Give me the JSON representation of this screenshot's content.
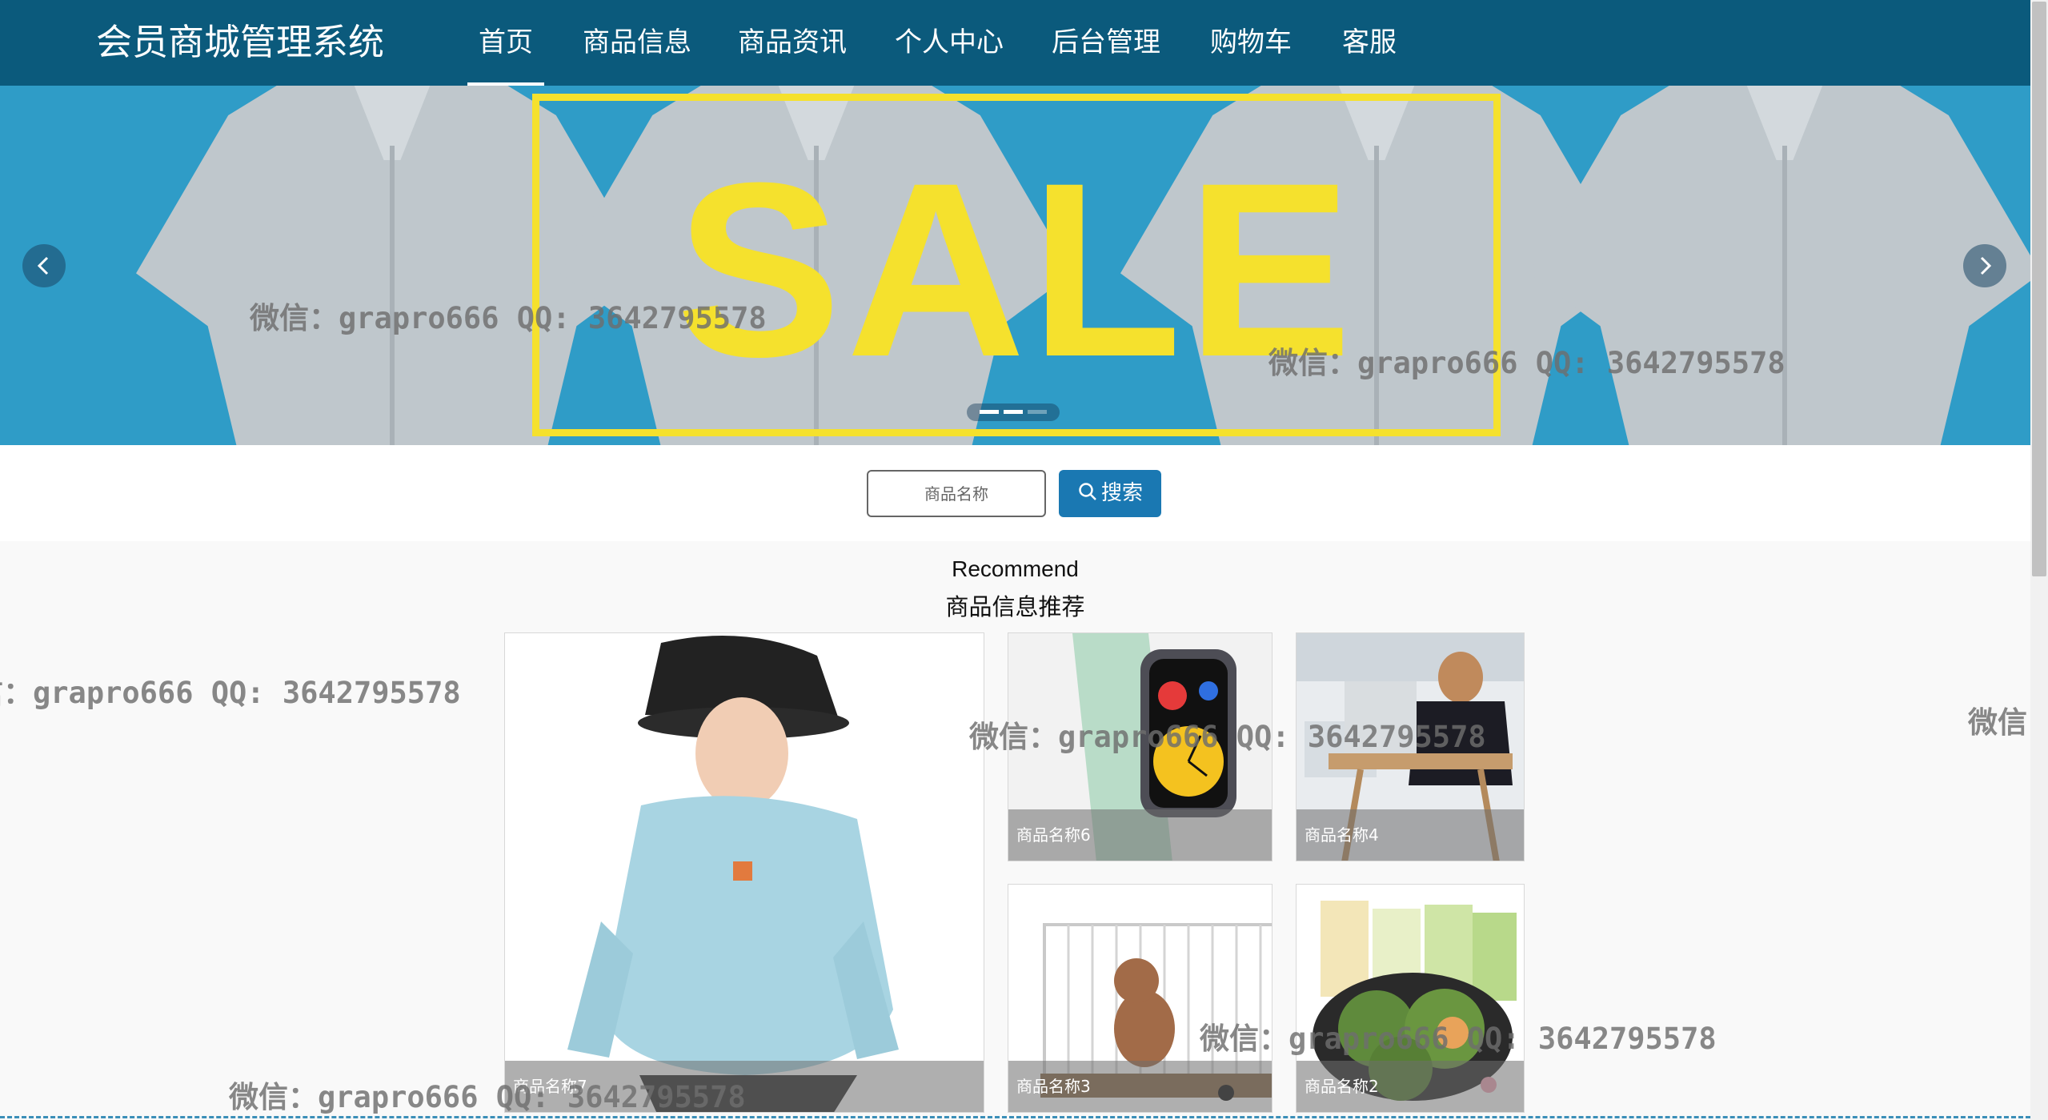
{
  "navbar": {
    "brand": "会员商城管理系统",
    "items": [
      {
        "label": "首页",
        "active": true
      },
      {
        "label": "商品信息"
      },
      {
        "label": "商品资讯"
      },
      {
        "label": "个人中心"
      },
      {
        "label": "后台管理"
      },
      {
        "label": "购物车"
      },
      {
        "label": "客服"
      }
    ],
    "color": "#0b5a7c"
  },
  "banner": {
    "sale_text": "SALE",
    "prev_icon": "chevron-left-icon",
    "next_icon": "chevron-right-icon",
    "slide_count": 3,
    "active_slide": 3,
    "colors": {
      "background": "#2f9cc7",
      "sale": "#f5e12d"
    }
  },
  "search": {
    "placeholder": "商品名称",
    "button_label": "搜索",
    "button_icon": "search-icon",
    "button_color": "#1a78b2"
  },
  "recommend": {
    "title_en": "Recommend",
    "title_cn": "商品信息推荐",
    "products": [
      {
        "name": "商品名称7",
        "image": "hoodie-photo"
      },
      {
        "name": "商品名称6",
        "image": "smartwatch-photo"
      },
      {
        "name": "商品名称4",
        "image": "laptop-desk-photo"
      },
      {
        "name": "商品名称3",
        "image": "dog-cage-photo"
      },
      {
        "name": "商品名称2",
        "image": "qingtuan-food-photo"
      }
    ]
  },
  "watermark": {
    "text": "微信：grapro666 QQ: 3642795578"
  }
}
